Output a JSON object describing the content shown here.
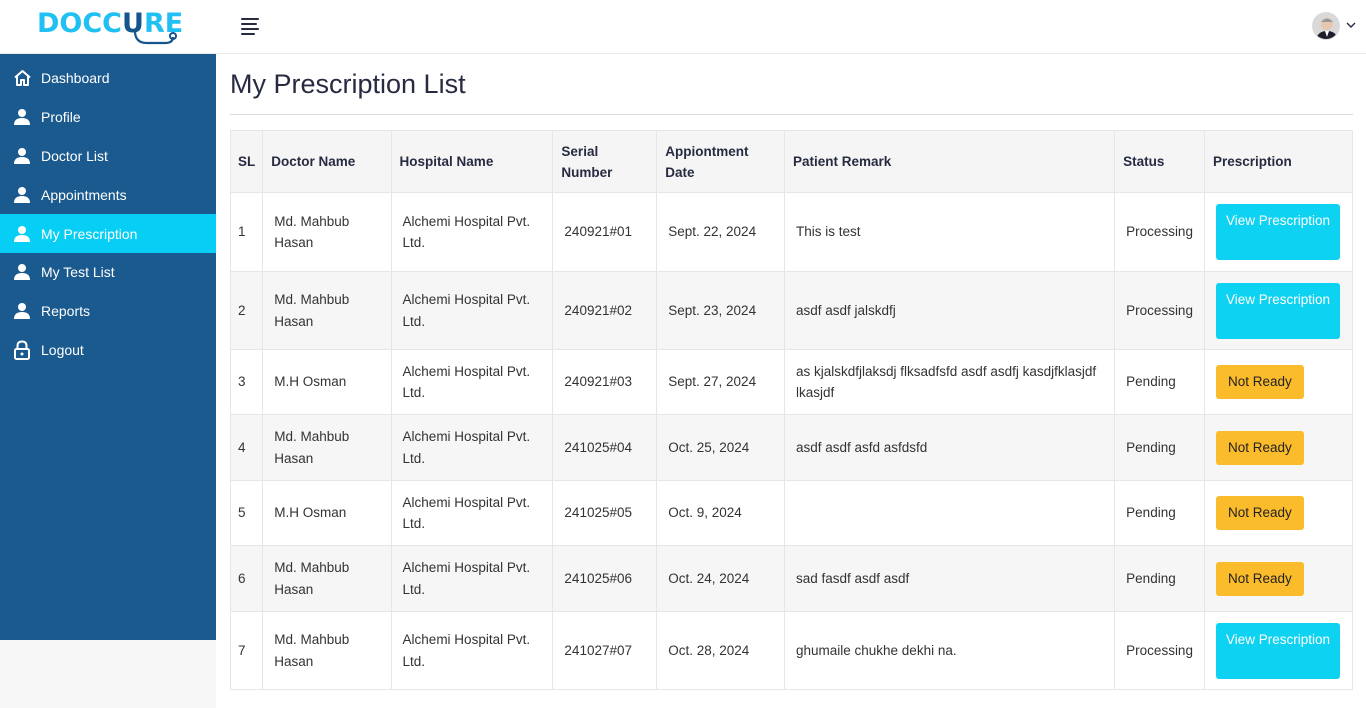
{
  "brand": {
    "name_part1": "DOCC",
    "name_part2": "U",
    "name_part3": "RE"
  },
  "sidebar": {
    "items": [
      {
        "label": "Dashboard",
        "icon": "home-icon"
      },
      {
        "label": "Profile",
        "icon": "user-icon"
      },
      {
        "label": "Doctor List",
        "icon": "user-icon"
      },
      {
        "label": "Appointments",
        "icon": "user-icon"
      },
      {
        "label": "My Prescription",
        "icon": "user-icon",
        "active": true
      },
      {
        "label": "My Test List",
        "icon": "user-icon"
      },
      {
        "label": "Reports",
        "icon": "user-icon"
      },
      {
        "label": "Logout",
        "icon": "lock-icon"
      }
    ]
  },
  "main": {
    "title": "My Prescription List",
    "table": {
      "headers": [
        "SL",
        "Doctor Name",
        "Hospital Name",
        "Serial Number",
        "Appiontment Date",
        "Patient Remark",
        "Status",
        "Prescription"
      ],
      "rows": [
        {
          "sl": "1",
          "doctor": "Md. Mahbub Hasan",
          "hospital": "Alchemi Hospital Pvt. Ltd.",
          "serial": "240921#01",
          "date": "Sept. 22, 2024",
          "remark": "This is test",
          "status": "Processing",
          "action": "View Prescription"
        },
        {
          "sl": "2",
          "doctor": "Md. Mahbub Hasan",
          "hospital": "Alchemi Hospital Pvt. Ltd.",
          "serial": "240921#02",
          "date": "Sept. 23, 2024",
          "remark": "asdf asdf jalskdfj",
          "status": "Processing",
          "action": "View Prescription"
        },
        {
          "sl": "3",
          "doctor": "M.H Osman",
          "hospital": "Alchemi Hospital Pvt. Ltd.",
          "serial": "240921#03",
          "date": "Sept. 27, 2024",
          "remark": "as kjalskdfjlaksdj flksadfsfd asdf asdfj kasdjfklasjdf lkasjdf",
          "status": "Pending",
          "action": "Not Ready"
        },
        {
          "sl": "4",
          "doctor": "Md. Mahbub Hasan",
          "hospital": "Alchemi Hospital Pvt. Ltd.",
          "serial": "241025#04",
          "date": "Oct. 25, 2024",
          "remark": "asdf asdf asfd asfdsfd",
          "status": "Pending",
          "action": "Not Ready"
        },
        {
          "sl": "5",
          "doctor": "M.H Osman",
          "hospital": "Alchemi Hospital Pvt. Ltd.",
          "serial": "241025#05",
          "date": "Oct. 9, 2024",
          "remark": "",
          "status": "Pending",
          "action": "Not Ready"
        },
        {
          "sl": "6",
          "doctor": "Md. Mahbub Hasan",
          "hospital": "Alchemi Hospital Pvt. Ltd.",
          "serial": "241025#06",
          "date": "Oct. 24, 2024",
          "remark": "sad fasdf asdf asdf",
          "status": "Pending",
          "action": "Not Ready"
        },
        {
          "sl": "7",
          "doctor": "Md. Mahbub Hasan",
          "hospital": "Alchemi Hospital Pvt. Ltd.",
          "serial": "241027#07",
          "date": "Oct. 28, 2024",
          "remark": "ghumaile chukhe dekhi na.",
          "status": "Processing",
          "action": "View Prescription"
        }
      ]
    }
  },
  "colors": {
    "sidebar": "#1b5a8e",
    "active": "#06cef4",
    "view_button": "#0dd2f2",
    "not_ready_button": "#fbbc2c"
  }
}
